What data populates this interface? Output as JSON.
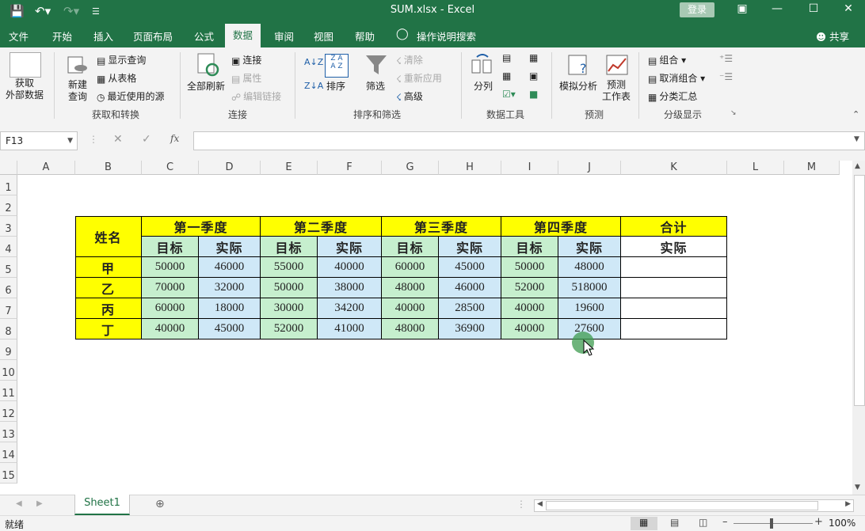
{
  "window": {
    "title": "SUM.xlsx  -  Excel",
    "login": "登录"
  },
  "menu": [
    "文件",
    "开始",
    "插入",
    "页面布局",
    "公式",
    "数据",
    "审阅",
    "视图",
    "帮助"
  ],
  "menu_active": "数据",
  "tell_me": "操作说明搜索",
  "share": "共享",
  "ribbon": {
    "get_data": "获取\n外部数据",
    "new_query": "新建\n查询",
    "show_query": "显示查询",
    "from_table": "从表格",
    "recent_sources": "最近使用的源",
    "group_get_transform": "获取和转换",
    "refresh_all": "全部刷新",
    "connections": "连接",
    "properties": "属性",
    "edit_links": "编辑链接",
    "group_connections": "连接",
    "sort": "排序",
    "filter": "筛选",
    "clear": "清除",
    "reapply": "重新应用",
    "advanced": "高级",
    "group_sort_filter": "排序和筛选",
    "text_to_columns": "分列",
    "group_data_tools": "数据工具",
    "what_if": "模拟分析",
    "forecast_sheet": "预测\n工作表",
    "group_forecast": "预测",
    "group_btn": "组合",
    "ungroup": "取消组合",
    "subtotal": "分类汇总",
    "group_outline": "分级显示"
  },
  "namebox": "F13",
  "columns": [
    "A",
    "B",
    "C",
    "D",
    "E",
    "F",
    "G",
    "H",
    "I",
    "J",
    "K",
    "L",
    "M"
  ],
  "rows": [
    "1",
    "2",
    "3",
    "4",
    "5",
    "6",
    "7",
    "8",
    "9",
    "10",
    "11",
    "12",
    "13",
    "14",
    "15"
  ],
  "table": {
    "name_header": "姓名",
    "quarters": [
      "第一季度",
      "第二季度",
      "第三季度",
      "第四季度"
    ],
    "total": "合计",
    "target": "目标",
    "actual": "实际",
    "names": [
      "甲",
      "乙",
      "丙",
      "丁"
    ],
    "values": [
      [
        "50000",
        "46000",
        "55000",
        "40000",
        "60000",
        "45000",
        "50000",
        "48000"
      ],
      [
        "70000",
        "32000",
        "50000",
        "38000",
        "48000",
        "46000",
        "52000",
        "518000"
      ],
      [
        "60000",
        "18000",
        "30000",
        "34200",
        "40000",
        "28500",
        "40000",
        "19600"
      ],
      [
        "40000",
        "45000",
        "52000",
        "41000",
        "48000",
        "36900",
        "40000",
        "27600"
      ]
    ]
  },
  "sheet_tab": "Sheet1",
  "status": "就绪",
  "zoom": "100%",
  "colors": {
    "green": "#217346",
    "yellow": "#ffff00",
    "lightgreen": "#c6efce",
    "lightblue": "#cfe8f7"
  }
}
